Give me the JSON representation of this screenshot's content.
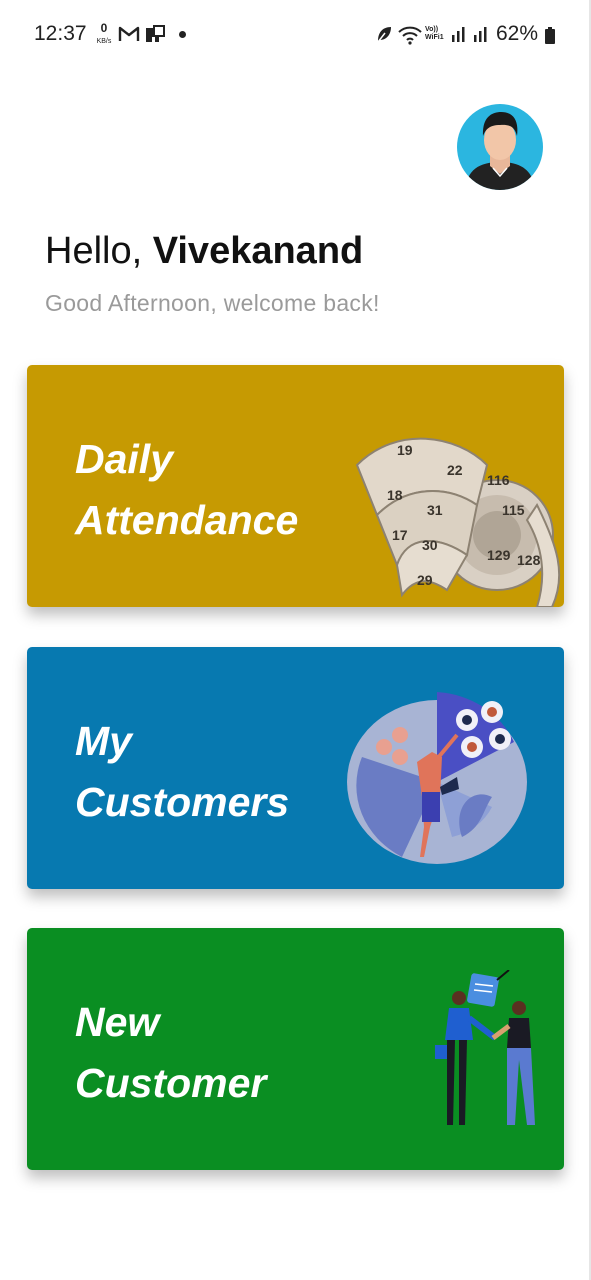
{
  "status_bar": {
    "time": "12:37",
    "net_speed_value": "0",
    "net_speed_unit": "KB/s",
    "volte_label": "Vo)) WiFi1",
    "battery_percent": "62%",
    "icons": [
      "gmail-icon",
      "notification-app-icon",
      "leaf-icon",
      "wifi-icon",
      "signal-icon",
      "battery-icon"
    ]
  },
  "header": {
    "greeting_prefix": "Hello, ",
    "user_name": "Vivekanand",
    "subtitle": "Good Afternoon, welcome back!"
  },
  "cards": [
    {
      "line1": "Daily",
      "line2": "Attendance",
      "color": "#c69a02",
      "illustration": "measuring-tape"
    },
    {
      "line1": "My",
      "line2": "Customers",
      "color": "#0779b0",
      "illustration": "customers-chart"
    },
    {
      "line1": "New",
      "line2": "Customer",
      "color": "#0a8e22",
      "illustration": "handshake"
    }
  ]
}
